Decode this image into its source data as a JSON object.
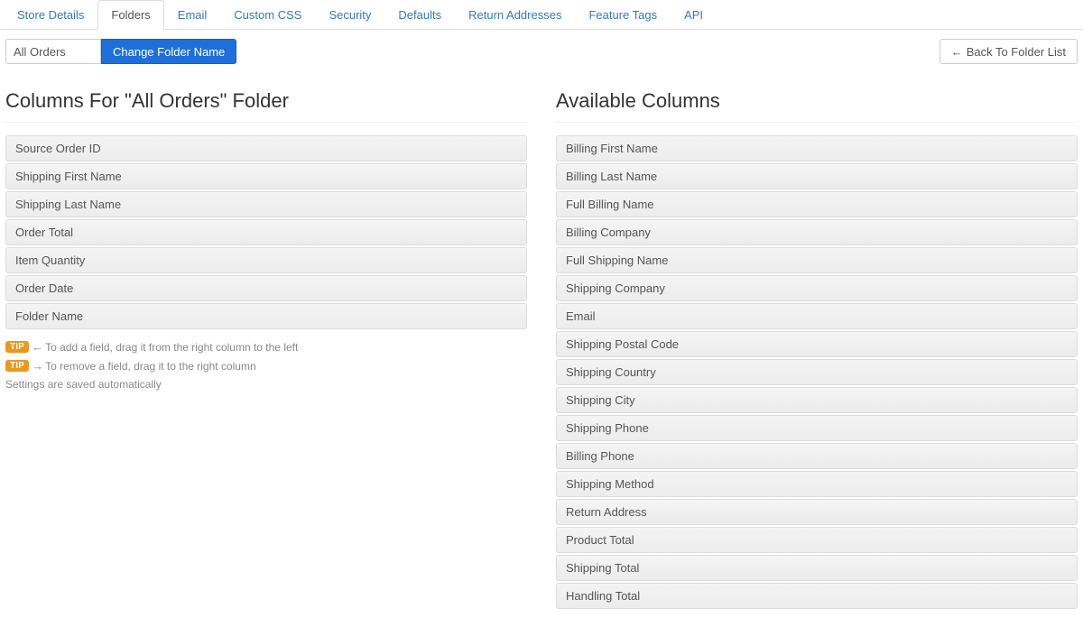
{
  "tabs": [
    {
      "label": "Store Details",
      "active": false
    },
    {
      "label": "Folders",
      "active": true
    },
    {
      "label": "Email",
      "active": false
    },
    {
      "label": "Custom CSS",
      "active": false
    },
    {
      "label": "Security",
      "active": false
    },
    {
      "label": "Defaults",
      "active": false
    },
    {
      "label": "Return Addresses",
      "active": false
    },
    {
      "label": "Feature Tags",
      "active": false
    },
    {
      "label": "API",
      "active": false
    }
  ],
  "toolbar": {
    "folder_name_value": "All Orders",
    "change_button": "Change Folder Name",
    "back_button": "Back To Folder List"
  },
  "headings": {
    "left": "Columns For \"All Orders\" Folder",
    "right": "Available Columns"
  },
  "left_columns": [
    "Source Order ID",
    "Shipping First Name",
    "Shipping Last Name",
    "Order Total",
    "Item Quantity",
    "Order Date",
    "Folder Name"
  ],
  "right_columns": [
    "Billing First Name",
    "Billing Last Name",
    "Full Billing Name",
    "Billing Company",
    "Full Shipping Name",
    "Shipping Company",
    "Email",
    "Shipping Postal Code",
    "Shipping Country",
    "Shipping City",
    "Shipping Phone",
    "Billing Phone",
    "Shipping Method",
    "Return Address",
    "Product Total",
    "Shipping Total",
    "Handling Total"
  ],
  "hints": {
    "tip_label": "TIP",
    "add_text": "To add a field, drag it from the right column to the left",
    "remove_text": "To remove a field, drag it to the right column",
    "autosave_text": "Settings are saved automatically"
  },
  "glyphs": {
    "arrow_left": "←",
    "arrow_right": "→"
  }
}
